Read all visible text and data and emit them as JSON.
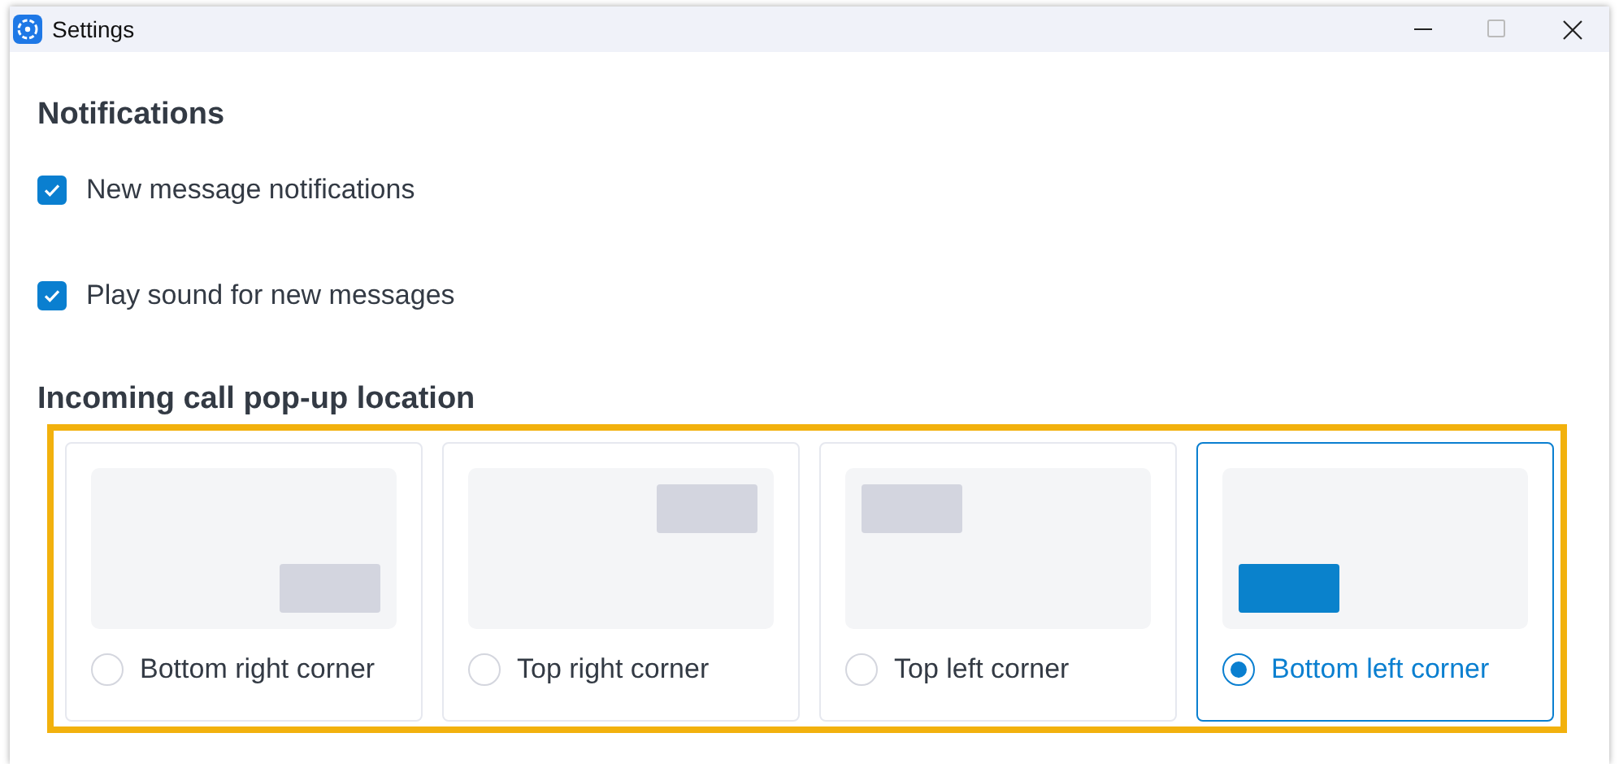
{
  "window": {
    "title": "Settings"
  },
  "notifications": {
    "heading": "Notifications",
    "options": [
      {
        "label": "New message notifications",
        "checked": true
      },
      {
        "label": "Play sound for new messages",
        "checked": true
      }
    ]
  },
  "popup_location": {
    "heading": "Incoming call pop-up location",
    "highlighted": true,
    "choices": [
      {
        "label": "Bottom right corner",
        "top": false,
        "left": false,
        "selected": false
      },
      {
        "label": "Top right corner",
        "top": true,
        "left": false,
        "selected": false
      },
      {
        "label": "Top left corner",
        "top": true,
        "left": true,
        "selected": false
      },
      {
        "label": "Bottom left corner",
        "top": false,
        "left": true,
        "selected": true
      }
    ]
  }
}
